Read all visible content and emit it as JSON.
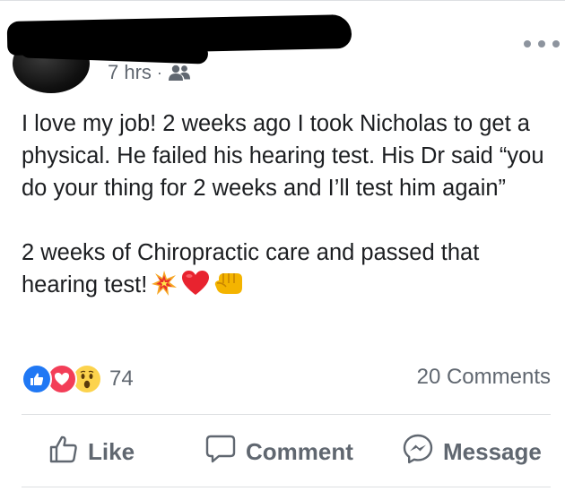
{
  "post": {
    "time": "7 hrs",
    "separator": "·",
    "audience_icon": "friends-icon",
    "text_paragraph_1": "I love my job! 2 weeks ago I took Nicholas to get a physical. He failed his hearing test. His Dr said “you do your thing for 2 weeks and I’ll test him again”",
    "text_paragraph_2": "2 weeks of Chiropractic care and passed that hearing test!",
    "emojis": [
      "collision-emoji",
      "red-heart-emoji",
      "fist-bump-emoji"
    ]
  },
  "reactions": {
    "types": [
      "like",
      "love",
      "wow"
    ],
    "count": "74",
    "comments": "20 Comments"
  },
  "actions": {
    "like": "Like",
    "comment": "Comment",
    "message": "Message"
  },
  "colors": {
    "like_blue": "#2078f4",
    "love_red": "#f33e58",
    "wow_yellow": "#fcd34d",
    "secondary_text": "#606770"
  }
}
